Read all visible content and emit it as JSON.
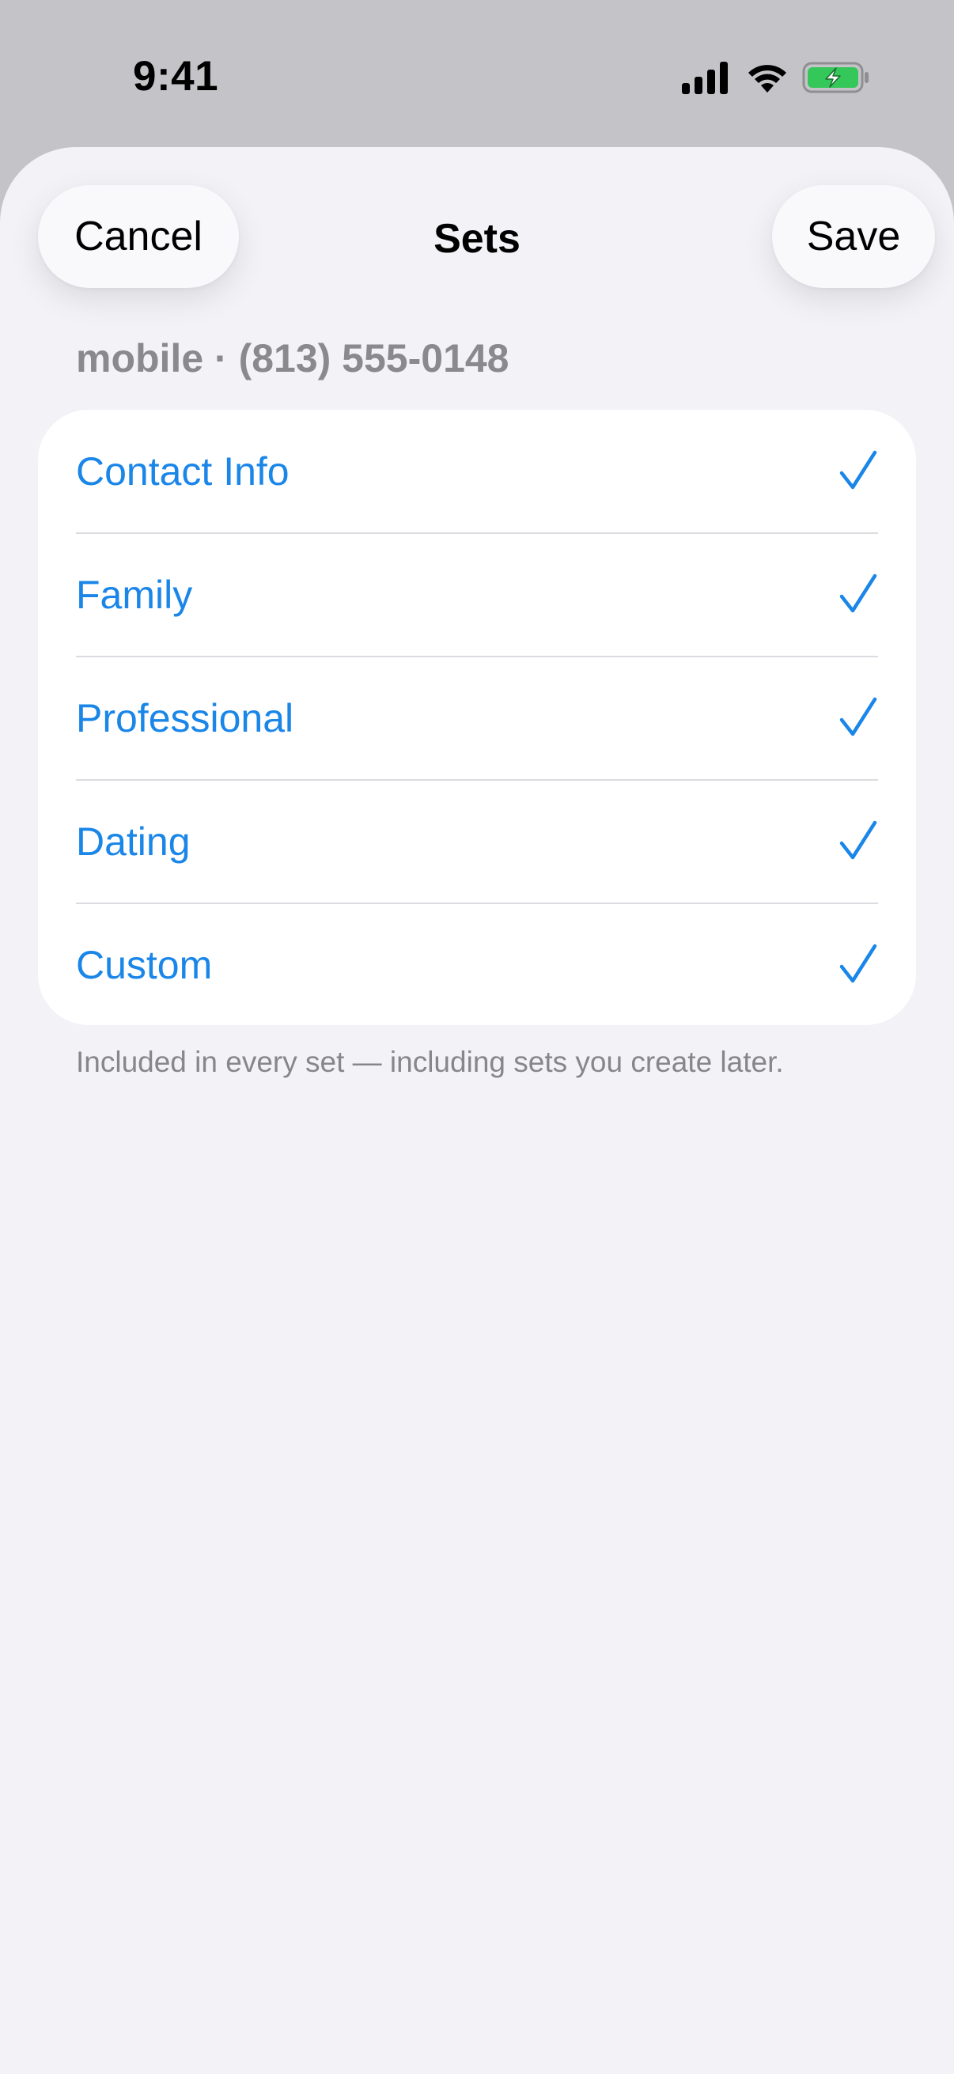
{
  "status_bar": {
    "time": "9:41",
    "icons": [
      "cellular-signal-icon",
      "wifi-icon",
      "battery-charging-icon"
    ],
    "battery_color": "#34c759"
  },
  "nav": {
    "cancel_label": "Cancel",
    "title": "Sets",
    "save_label": "Save"
  },
  "subtitle": "mobile · (813) 555-0148",
  "sets": [
    {
      "label": "Contact Info",
      "checked": true
    },
    {
      "label": "Family",
      "checked": true
    },
    {
      "label": "Professional",
      "checked": true
    },
    {
      "label": "Dating",
      "checked": true
    },
    {
      "label": "Custom",
      "checked": true
    }
  ],
  "footnote": "Included in every set — including sets you create later.",
  "colors": {
    "accent": "#1a86e8",
    "background": "#f2f2f7",
    "secondary_text": "#8a8a8e"
  }
}
